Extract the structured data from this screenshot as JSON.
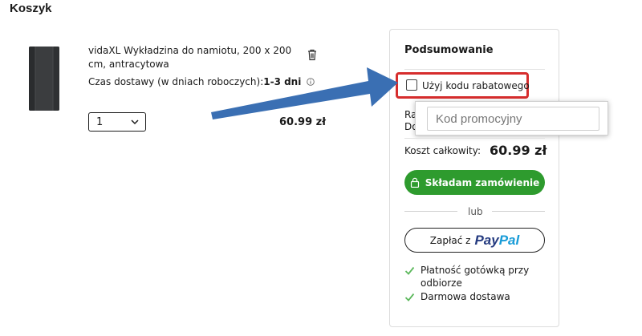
{
  "page": {
    "title": "Koszyk"
  },
  "cart": {
    "item": {
      "name": "vidaXL Wykładzina do namiotu, 200 x 200 cm, antracytowa",
      "delivery_label": "Czas dostawy (w dniach roboczych):",
      "delivery_value": "1-3 dni",
      "quantity": "1",
      "price": "60.99 zł"
    }
  },
  "summary": {
    "title": "Podsumowanie",
    "discount_checkbox_label": "Użyj kodu rabatowego",
    "discount_checked": false,
    "hidden_line_1": "Ra",
    "hidden_line_2": "Do",
    "promo_input_placeholder": "Kod promocyjny",
    "promo_input_value": "",
    "total_label": "Koszt całkowity:",
    "total_value": "60.99 zł",
    "order_button_label": "Składam zamówienie",
    "or_label": "lub",
    "paypal_prefix": "Zapłać z",
    "paypal_logo_part1": "Pay",
    "paypal_logo_part2": "Pal",
    "features": [
      "Płatność gotówką przy odbiorze",
      "Darmowa dostawa"
    ]
  },
  "icons": {
    "trash": "trash-icon",
    "info": "info-icon",
    "chevron": "chevron-down-icon",
    "lock": "lock-icon",
    "check": "check-icon",
    "arrow": "annotation-arrow"
  },
  "colors": {
    "accent_green": "#2e9b2e",
    "highlight_red": "#d62d2d",
    "arrow_blue": "#3a6fb3",
    "paypal_dark": "#253b80",
    "paypal_light": "#179bd7"
  }
}
